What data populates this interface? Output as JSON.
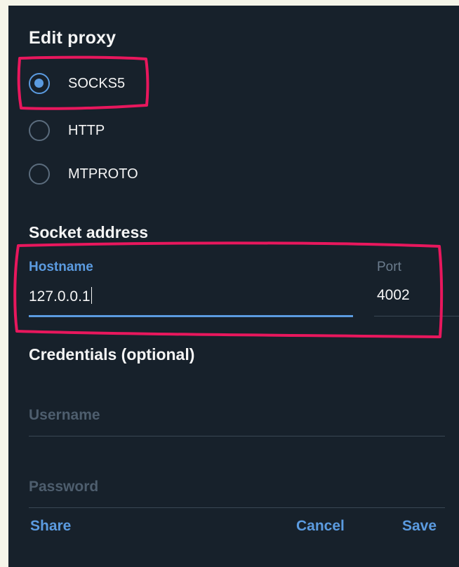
{
  "dialog": {
    "title": "Edit proxy"
  },
  "proxy_types": [
    {
      "label": "SOCKS5",
      "checked": true
    },
    {
      "label": "HTTP",
      "checked": false
    },
    {
      "label": "MTPROTO",
      "checked": false
    }
  ],
  "socket_address": {
    "section_title": "Socket address",
    "hostname_label": "Hostname",
    "hostname_value": "127.0.0.1",
    "port_label": "Port",
    "port_value": "4002"
  },
  "credentials": {
    "section_title": "Credentials (optional)",
    "username_placeholder": "Username",
    "password_placeholder": "Password"
  },
  "buttons": {
    "share_label": "Share",
    "cancel_label": "Cancel",
    "save_label": "Save"
  },
  "colors": {
    "background": "#17212b",
    "accent": "#5b9be0",
    "annotation": "#e8175d"
  }
}
